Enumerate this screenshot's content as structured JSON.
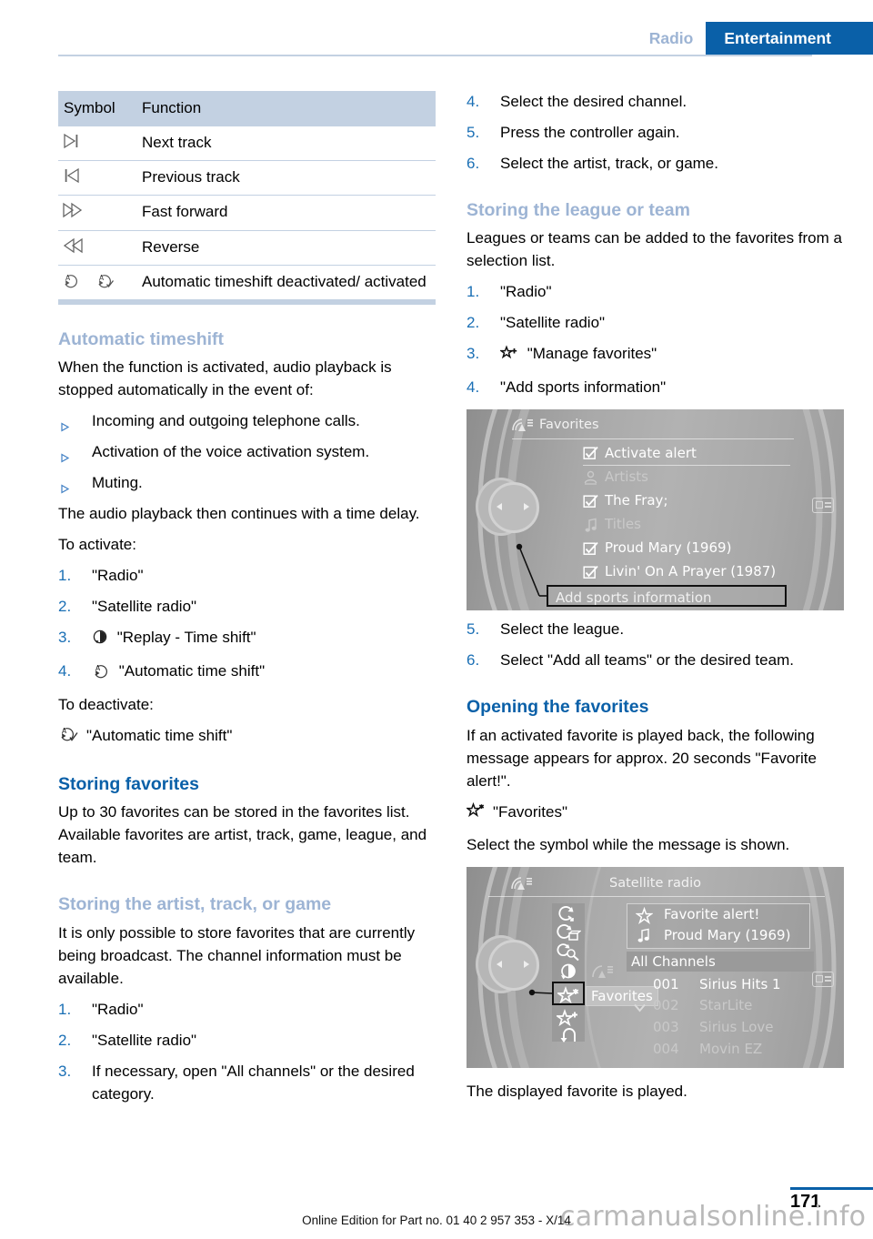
{
  "header": {
    "tab_inactive": "Radio",
    "tab_active": "Entertainment",
    "accent_blue": "#0a60a8",
    "light_blue": "#9db4d4"
  },
  "left_column": {
    "table": {
      "headers": [
        "Symbol",
        "Function"
      ],
      "rows": [
        {
          "symbols": [
            "next-track-icon"
          ],
          "function": "Next track"
        },
        {
          "symbols": [
            "previous-track-icon"
          ],
          "function": "Previous track"
        },
        {
          "symbols": [
            "fast-forward-icon"
          ],
          "function": "Fast forward"
        },
        {
          "symbols": [
            "reverse-icon"
          ],
          "function": "Reverse"
        },
        {
          "symbols": [
            "auto-timeshift-off-icon",
            "auto-timeshift-on-icon"
          ],
          "function": "Automatic timeshift deactivated/ activated"
        }
      ]
    },
    "sections": [
      {
        "heading": "Automatic timeshift",
        "heading_level": "sub",
        "paragraphs": [
          "When the function is activated, audio playback is stopped automatically in the event of:"
        ],
        "bullets": [
          "Incoming and outgoing telephone calls.",
          "Activation of the voice activation system.",
          "Muting."
        ],
        "paragraph_after": "The audio playback then continues with a time delay.",
        "lead_in": "To activate:",
        "steps": [
          {
            "num": "1.",
            "text": "\"Radio\""
          },
          {
            "num": "2.",
            "text": "\"Satellite radio\""
          },
          {
            "num": "3.",
            "icon": "replay-timeshift-icon",
            "text": "\"Replay - Time shift\""
          },
          {
            "num": "4.",
            "icon": "auto-timeshift-off-icon",
            "text": "\"Automatic time shift\""
          }
        ],
        "lead_out": "To deactivate:",
        "icon_line": {
          "icon": "auto-timeshift-on-icon",
          "text": "\"Automatic time shift\""
        }
      },
      {
        "heading": "Storing favorites",
        "heading_level": "main",
        "paragraphs": [
          "Up to 30 favorites can be stored in the favorites list. Available favorites are artist, track, game, league, and team."
        ]
      },
      {
        "heading": "Storing the artist, track, or game",
        "heading_level": "sub",
        "paragraphs": [
          "It is only possible to store favorites that are currently being broadcast. The channel information must be available."
        ],
        "steps": [
          {
            "num": "1.",
            "text": "\"Radio\""
          },
          {
            "num": "2.",
            "text": "\"Satellite radio\""
          },
          {
            "num": "3.",
            "text": "If necessary, open \"All channels\" or the desired category."
          }
        ]
      }
    ]
  },
  "right_column": {
    "steps_continued": [
      {
        "num": "4.",
        "text": "Select the desired channel."
      },
      {
        "num": "5.",
        "text": "Press the controller again."
      },
      {
        "num": "6.",
        "text": "Select the artist, track, or game."
      }
    ],
    "sections": [
      {
        "heading": "Storing the league or team",
        "heading_level": "sub",
        "paragraphs": [
          "Leagues or teams can be added to the favorites from a selection list."
        ],
        "steps": [
          {
            "num": "1.",
            "text": "\"Radio\""
          },
          {
            "num": "2.",
            "text": "\"Satellite radio\""
          },
          {
            "num": "3.",
            "icon": "manage-favorites-icon",
            "text": "\"Manage favorites\""
          },
          {
            "num": "4.",
            "text": "\"Add sports information\""
          }
        ],
        "steps_after_image": [
          {
            "num": "5.",
            "text": "Select the league."
          },
          {
            "num": "6.",
            "text": "Select \"Add all teams\" or the desired team."
          }
        ]
      },
      {
        "heading": "Opening the favorites",
        "heading_level": "main",
        "paragraphs": [
          "If an activated favorite is played back, the following message appears for approx. 20 seconds \"Favorite alert!\"."
        ],
        "icon_line": {
          "icon": "favorites-star-icon",
          "text": "\"Favorites\""
        },
        "paragraph_after": "Select the symbol while the message is shown.",
        "caption_after_image": "The displayed favorite is played."
      }
    ]
  },
  "screenshot_favorites": {
    "title": "Favorites",
    "status_icon": "satellite-radio-icon",
    "items": [
      {
        "icon": "checkbox-checked-icon",
        "label": "Activate alert",
        "dim": false
      },
      {
        "icon": "artists-icon",
        "label": "Artists",
        "dim": true
      },
      {
        "icon": "checkbox-checked-icon",
        "label": "The Fray;",
        "dim": false
      },
      {
        "icon": "music-note-icon",
        "label": "Titles",
        "dim": true
      },
      {
        "icon": "checkbox-checked-icon",
        "label": "Proud Mary (1969)",
        "dim": false
      },
      {
        "icon": "checkbox-checked-icon",
        "label": "Livin' On A Prayer (1987)",
        "dim": false
      }
    ],
    "highlighted_item": "Add sports information",
    "right_icon": "display-icon"
  },
  "screenshot_satellite": {
    "title": "Satellite radio",
    "status_icon": "satellite-radio-icon",
    "toolbar_icons": [
      "refresh-channel-icon",
      "browse-channel-icon",
      "search-channel-icon",
      "replay-timeshift-icon",
      "favorites-star-icon",
      "manage-favorites-icon",
      "back-arrow-icon"
    ],
    "highlighted_toolbar_index": 4,
    "tooltip": "Favorites",
    "message_rows": [
      {
        "icon": "star-icon",
        "label": "Favorite alert!"
      },
      {
        "icon": "music-note-icon",
        "label": "Proud Mary (1969)"
      }
    ],
    "list_header": "All Channels",
    "channels": [
      {
        "number": "001",
        "name": "Sirius Hits 1",
        "dim": false
      },
      {
        "number": "002",
        "name": "StarLite",
        "dim": true,
        "marker": "chevron-down-icon"
      },
      {
        "number": "003",
        "name": "Sirius Love",
        "dim": true
      },
      {
        "number": "004",
        "name": "Movin EZ",
        "dim": true
      }
    ],
    "right_icon": "display-icon"
  },
  "footer": {
    "page_number": "171",
    "edition_text": "Online Edition for Part no. 01 40 2 957 353 - X/14",
    "watermark": "carmanualsonline.info"
  }
}
